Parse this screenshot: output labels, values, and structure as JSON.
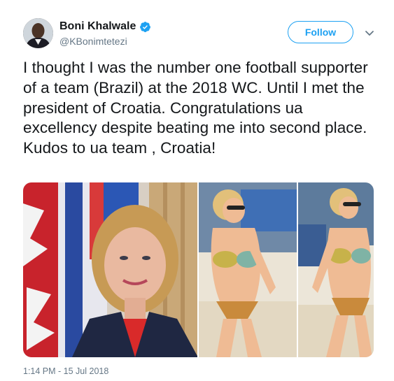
{
  "tweet": {
    "author": {
      "display_name": "Boni Khalwale",
      "handle": "@KBonimtetezi",
      "verified": true,
      "avatar_icon": "user-avatar"
    },
    "follow_label": "Follow",
    "menu_icon": "chevron-down-icon",
    "text": "I thought I was the number one football supporter of a team (Brazil) at the 2018 WC. Until I met the president of Croatia. Congratulations ua excellency despite beating me into second place. Kudos to ua team , Croatia!",
    "timestamp": "1:14 PM - 15 Jul 2018"
  },
  "colors": {
    "accent": "#1da1f2",
    "text_primary": "#14171a",
    "text_secondary": "#657786"
  }
}
